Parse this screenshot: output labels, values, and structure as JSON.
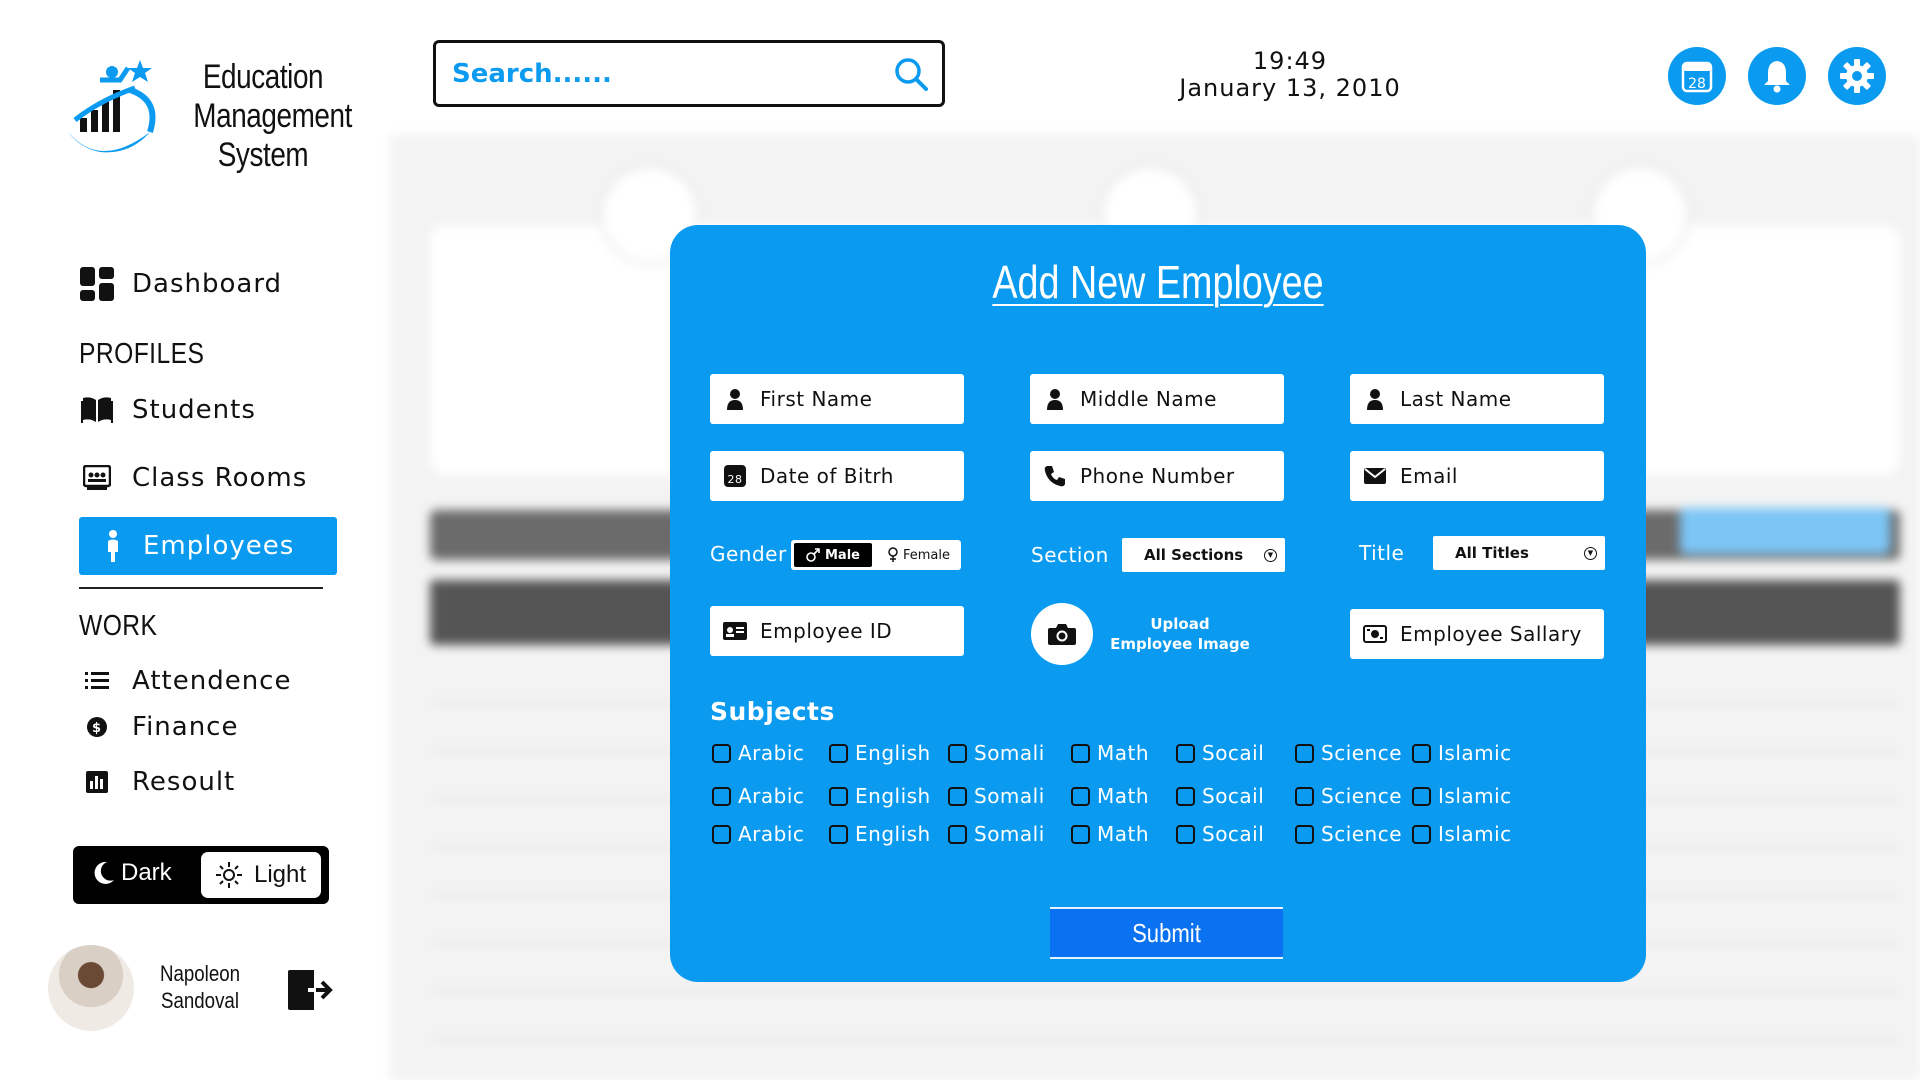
{
  "app": {
    "title_lines": [
      "Education",
      "Management",
      "System"
    ]
  },
  "search": {
    "placeholder": "Search......"
  },
  "clock": {
    "time": "19:49",
    "date": "January 13, 2010"
  },
  "header_icons": {
    "calendar_icon": "calendar-icon",
    "calendar_day": "28",
    "bell_icon": "bell-icon",
    "gear_icon": "gear-icon"
  },
  "sidebar": {
    "dashboard_label": "Dashboard",
    "profiles_heading": "PROFILES",
    "students_label": "Students",
    "classrooms_label": "Class Rooms",
    "employees_label": "Employees",
    "work_heading": "WORK",
    "attendance_label": "Attendence",
    "finance_label": "Finance",
    "result_label": "Resoult"
  },
  "theme": {
    "dark_label": "Dark",
    "light_label": "Light",
    "selected": "Light"
  },
  "user": {
    "name_lines": [
      "Napoleon",
      "Sandoval"
    ]
  },
  "modal": {
    "title": "Add New Employee",
    "fields": {
      "first_name": "First Name",
      "middle_name": "Middle Name",
      "last_name": "Last Name",
      "dob": "Date of Bitrh",
      "dob_icon_day": "28",
      "phone": "Phone Number",
      "email": "Email",
      "employee_id": "Employee ID",
      "salary": "Employee Sallary"
    },
    "gender": {
      "label": "Gender",
      "male": "Male",
      "female": "Female",
      "selected": "Male"
    },
    "section": {
      "label": "Section",
      "value": "All Sections"
    },
    "title_select": {
      "label": "Title",
      "value": "All Titles"
    },
    "upload": {
      "line1": "Upload",
      "line2": "Employee Image"
    },
    "subjects_heading": "Subjects",
    "subjects": [
      [
        "Arabic",
        "English",
        "Somali",
        "Math",
        "Socail",
        "Science",
        "Islamic"
      ],
      [
        "Arabic",
        "English",
        "Somali",
        "Math",
        "Socail",
        "Science",
        "Islamic"
      ],
      [
        "Arabic",
        "English",
        "Somali",
        "Math",
        "Socail",
        "Science",
        "Islamic"
      ]
    ],
    "submit_label": "Submit"
  },
  "colors": {
    "accent": "#0a9bf0",
    "submit": "#0a72f0",
    "text": "#111111"
  }
}
